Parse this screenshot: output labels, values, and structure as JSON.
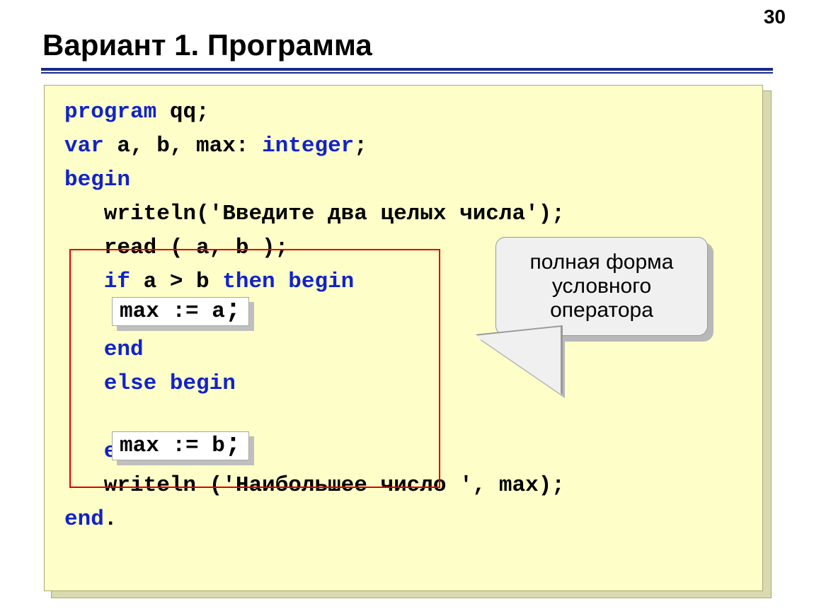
{
  "page_number": "30",
  "title": "Вариант 1. Программа",
  "code": {
    "l1a": "program",
    "l1b": " qq;",
    "l2a": "var",
    "l2b": " a, b, max: ",
    "l2c": "integer",
    "l2d": ";",
    "l3a": "begin",
    "l4a": "   writeln('Введите два целых числа');",
    "l5a": "   read ( a, b );",
    "l6a": "   if",
    "l6b": " a > b ",
    "l6c": "then begin",
    "l8a": "   end",
    "l9a": "   else begin",
    "l11a": "   end",
    "l11b": ";",
    "l12a": "   writeln ('Наибольшее число ', max);",
    "l13a": "end",
    "l13b": "."
  },
  "snippet_a": "max := a",
  "snippet_b": "max := b",
  "snippet_semicolon": ";",
  "callout": "полная форма условного оператора"
}
